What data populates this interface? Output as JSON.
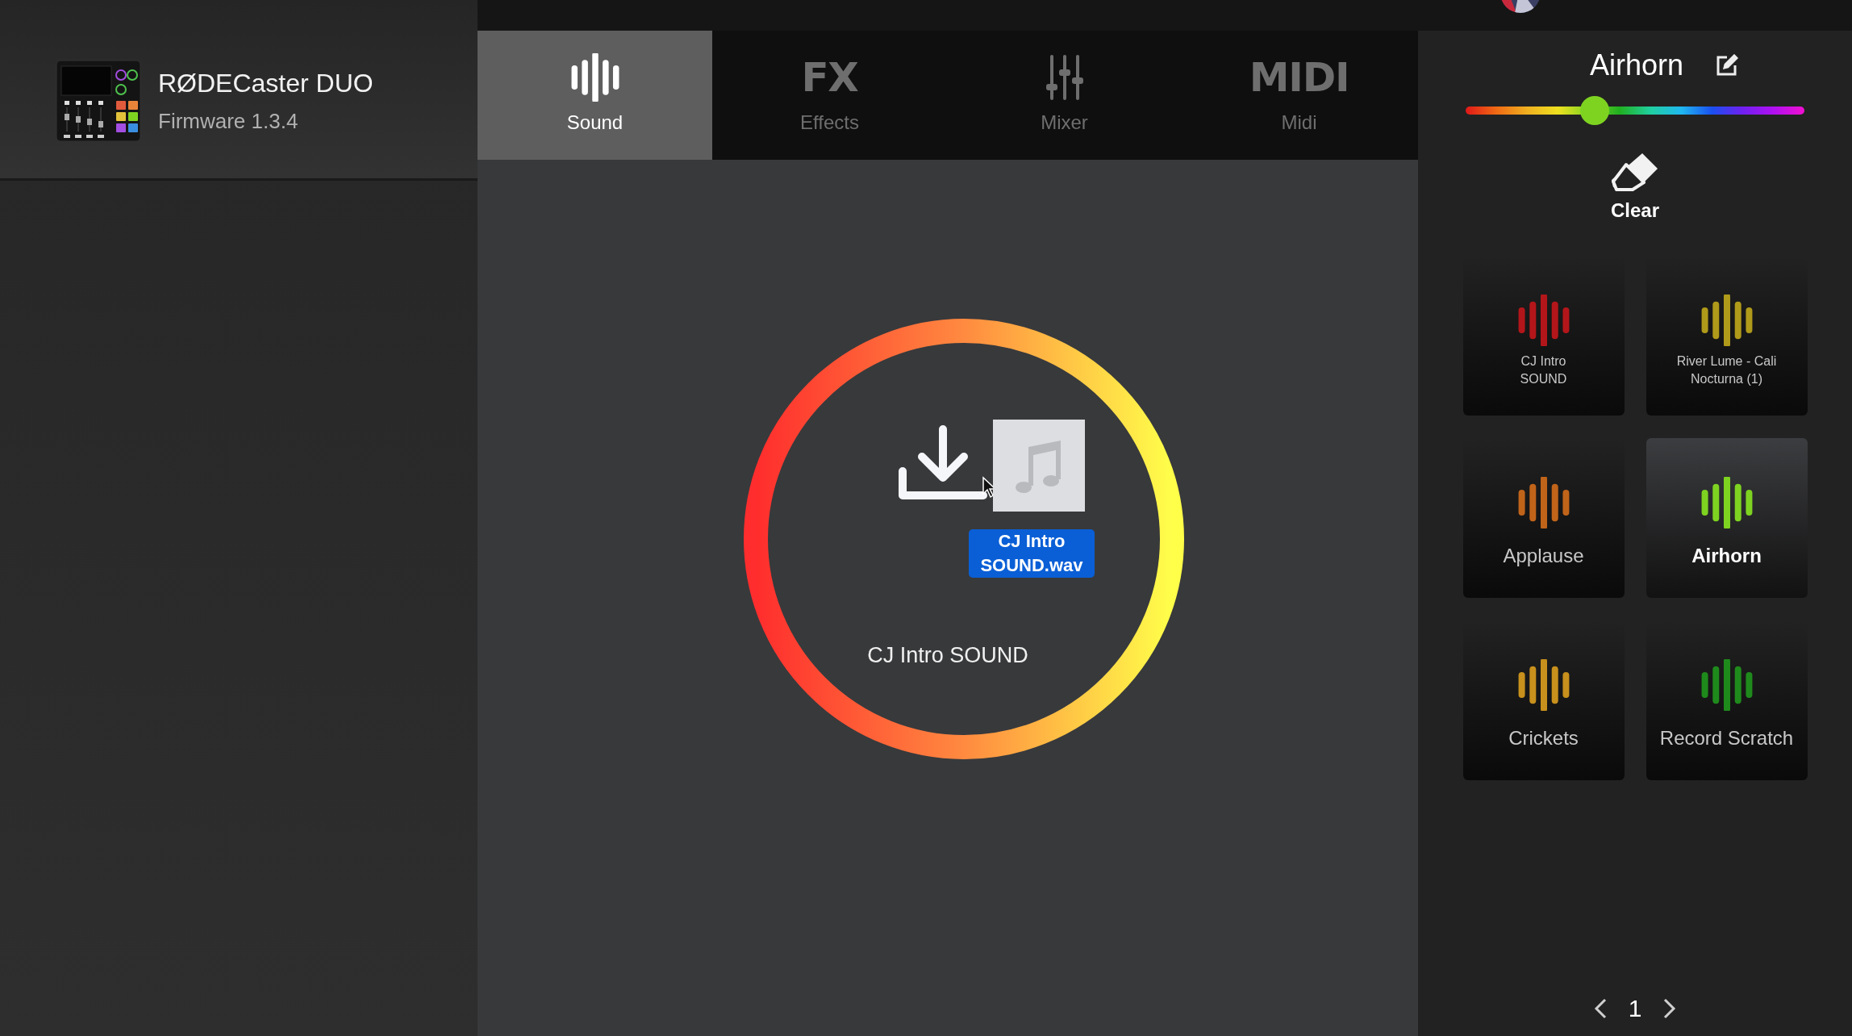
{
  "device": {
    "name": "RØDECaster DUO",
    "firmware": "Firmware 1.3.4"
  },
  "tabs": [
    {
      "label": "Sound",
      "kind": "wave",
      "selected": true
    },
    {
      "label": "Effects",
      "kind": "text",
      "icon_text": "FX",
      "selected": false
    },
    {
      "label": "Mixer",
      "kind": "sliders",
      "selected": false
    },
    {
      "label": "Midi",
      "kind": "text",
      "icon_text": "MIDI",
      "selected": false
    }
  ],
  "drop_zone": {
    "file_label": "CJ Intro SOUND.wav",
    "title": "CJ Intro SOUND"
  },
  "pad_editor": {
    "name": "Airhorn",
    "color_slider": {
      "level": 0.38,
      "color": "#7ed321"
    },
    "clear_label": "Clear"
  },
  "pads": [
    {
      "lines": [
        "CJ Intro",
        "SOUND"
      ],
      "color": "#b3161a",
      "selected": false
    },
    {
      "lines": [
        "River Lume - Cali",
        "Nocturna (1)"
      ],
      "color": "#b09a1a",
      "selected": false
    },
    {
      "lines": [
        "Applause"
      ],
      "color": "#c0641a",
      "selected": false
    },
    {
      "lines": [
        "Airhorn"
      ],
      "color": "#7ed321",
      "selected": true
    },
    {
      "lines": [
        "Crickets"
      ],
      "color": "#c8901c",
      "selected": false
    },
    {
      "lines": [
        "Record Scratch"
      ],
      "color": "#1f8a1c",
      "selected": false
    }
  ],
  "pager": {
    "page": "1"
  }
}
